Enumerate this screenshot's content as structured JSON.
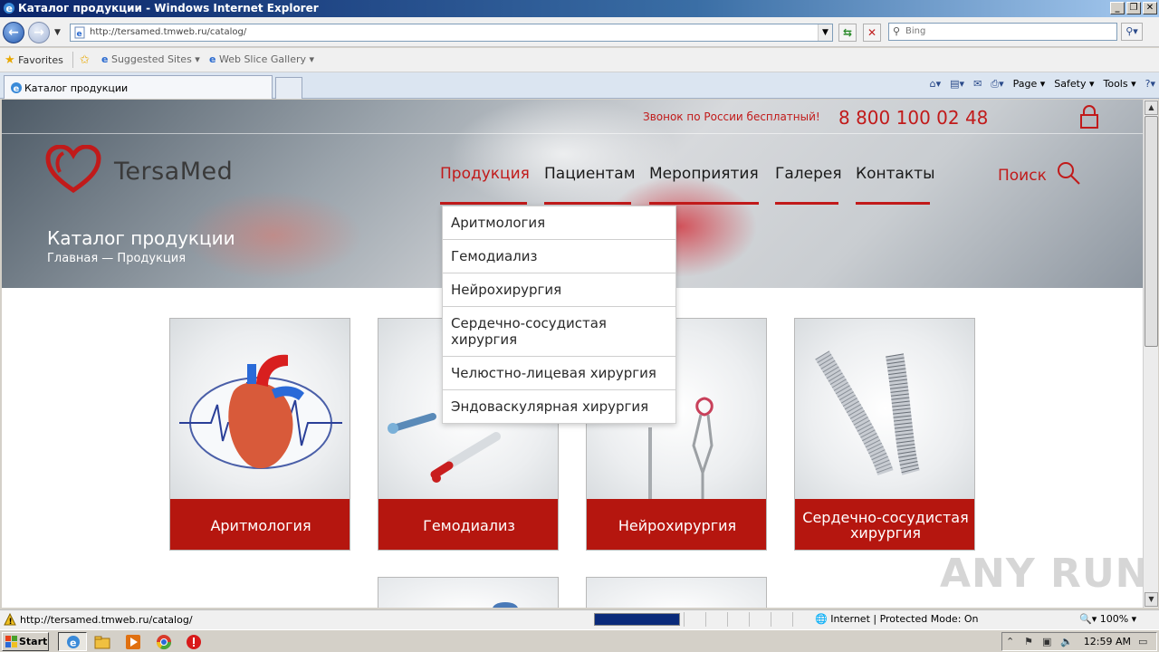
{
  "window": {
    "title": "Каталог продукции - Windows Internet Explorer"
  },
  "address": {
    "url": "http://tersamed.tmweb.ru/catalog/",
    "search_placeholder": "Bing"
  },
  "favorites": {
    "favorites_label": "Favorites",
    "suggested_label": "Suggested Sites ▾",
    "webslice_label": "Web Slice Gallery ▾"
  },
  "tab": {
    "label": "Каталог продукции"
  },
  "commandbar": {
    "page": "Page ▾",
    "safety": "Safety ▾",
    "tools": "Tools ▾",
    "help": "?▾"
  },
  "site": {
    "call_free": "Звонок по России бесплатный!",
    "phone": "8 800 100 02 48",
    "brand": "TersaMed",
    "nav": [
      "Продукция",
      "Пациентам",
      "Мероприятия",
      "Галерея",
      "Контакты"
    ],
    "search_label": "Поиск",
    "page_title": "Каталог продукции",
    "breadcrumb_home": "Главная",
    "breadcrumb_sep": " — ",
    "breadcrumb_current": "Продукция",
    "dropdown": [
      "Аритмология",
      "Гемодиализ",
      "Нейрохирургия",
      "Сердечно-сосудистая хирургия",
      "Челюстно-лицевая хирургия",
      "Эндоваскулярная хирургия"
    ],
    "cards": [
      "Аритмология",
      "Гемодиализ",
      "Нейрохирургия",
      "Сердечно-сосудистая хирургия"
    ],
    "accent_color": "#b5160f"
  },
  "watermark": "ANY RUN",
  "status": {
    "url": "http://tersamed.tmweb.ru/catalog/",
    "zone": "Internet | Protected Mode: On",
    "zoom": "100%",
    "progress": 1.0
  },
  "taskbar": {
    "start_label": "Start",
    "clock": "12:59 AM"
  }
}
